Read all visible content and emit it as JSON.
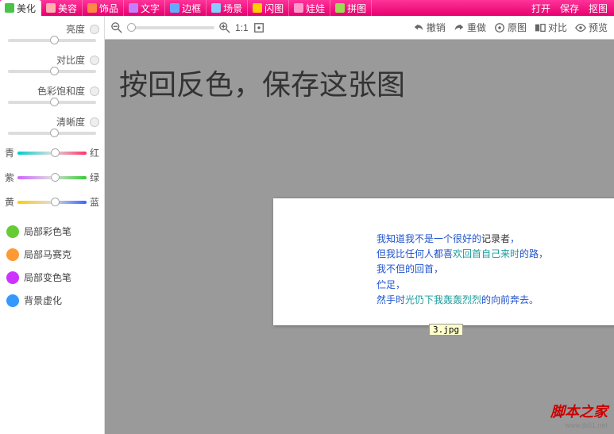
{
  "tabs": [
    {
      "label": "美化",
      "color": "#4ac24a",
      "active": true
    },
    {
      "label": "美容",
      "color": "#ffb0b0"
    },
    {
      "label": "饰品",
      "color": "#ff8844"
    },
    {
      "label": "文字",
      "color": "#c080ff"
    },
    {
      "label": "边框",
      "color": "#66aaff"
    },
    {
      "label": "场景",
      "color": "#88ccff"
    },
    {
      "label": "闪图",
      "color": "#ffcc00"
    },
    {
      "label": "娃娃",
      "color": "#ff99cc"
    },
    {
      "label": "拼图",
      "color": "#99dd55"
    }
  ],
  "topRight": [
    "打开",
    "保存",
    "抠图"
  ],
  "sliders": [
    {
      "label": "亮度"
    },
    {
      "label": "对比度"
    },
    {
      "label": "色彩饱和度"
    },
    {
      "label": "清晰度"
    }
  ],
  "colorSliders": [
    {
      "left": "青",
      "right": "红",
      "g": "linear-gradient(90deg,#00cccc,#ddd,#ff3366)"
    },
    {
      "left": "紫",
      "right": "绿",
      "g": "linear-gradient(90deg,#cc66ff,#ddd,#33cc33)"
    },
    {
      "left": "黄",
      "right": "蓝",
      "g": "linear-gradient(90deg,#ffcc00,#ddd,#3366ff)"
    }
  ],
  "tools": [
    {
      "label": "局部彩色笔",
      "color": "#66cc33"
    },
    {
      "label": "局部马赛克",
      "color": "#ff9933"
    },
    {
      "label": "局部变色笔",
      "color": "#cc33ff"
    },
    {
      "label": "背景虚化",
      "color": "#3399ff"
    }
  ],
  "toolbar": {
    "zoomRatio": "1:1",
    "undo": "撤销",
    "redo": "重做",
    "original": "原图",
    "compare": "对比",
    "preview": "预览"
  },
  "overlay": "按回反色，保存这张图",
  "doc": {
    "lines": [
      [
        {
          "t": "我知道我不是一个很好的",
          "c": "k0"
        },
        {
          "t": "记录者",
          "c": "k1"
        },
        {
          "t": "，",
          "c": "k0"
        }
      ],
      [
        {
          "t": "但我比任何人都喜",
          "c": "k0"
        },
        {
          "t": "欢回首自己来时",
          "c": "k2"
        },
        {
          "t": "的路，",
          "c": "k0"
        }
      ],
      [
        {
          "t": "我不但的回首，",
          "c": "k0"
        }
      ],
      [
        {
          "t": "伫足，",
          "c": "k0"
        }
      ],
      [
        {
          "t": "然手时",
          "c": "k0"
        },
        {
          "t": "光仍下我轰轰烈烈",
          "c": "k2"
        },
        {
          "t": "的向前奔去。",
          "c": "k0"
        }
      ]
    ]
  },
  "filename": "3.jpg",
  "watermark": {
    "main": "脚本之家",
    "sub": "www.jb51.net"
  }
}
